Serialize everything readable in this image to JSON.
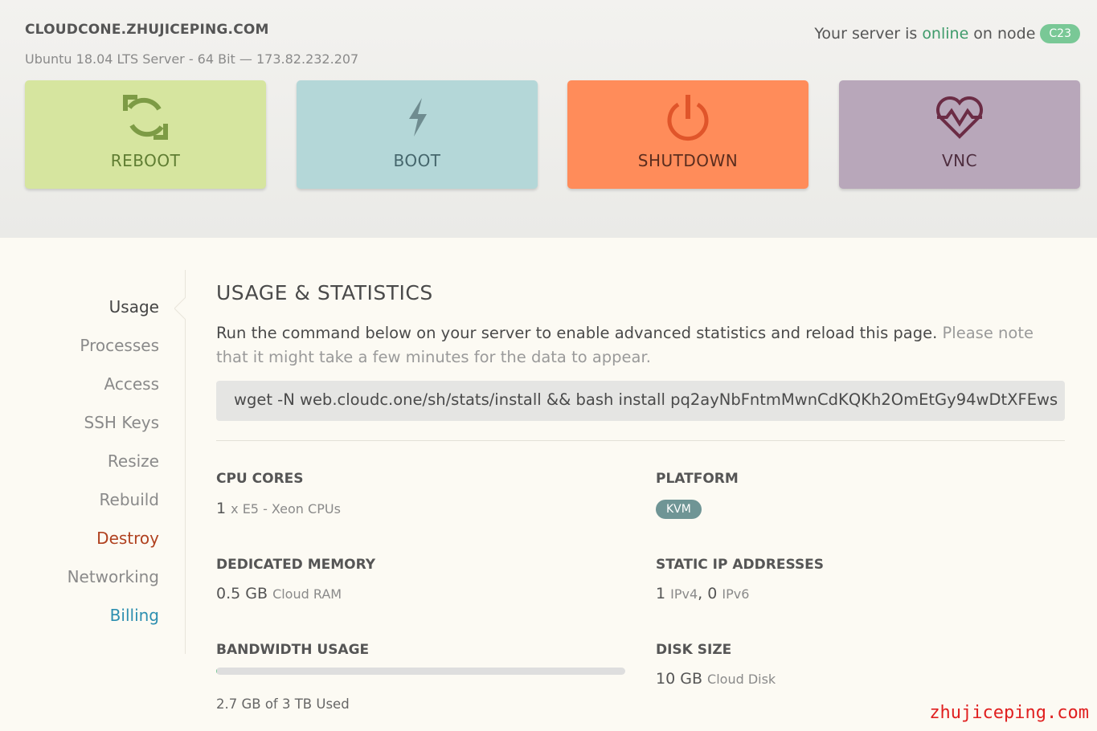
{
  "header": {
    "hostname": "CLOUDCONE.ZHUJICEPING.COM",
    "subline": "Ubuntu 18.04 LTS Server - 64 Bit — 173.82.232.207",
    "status_prefix": "Your server is",
    "status_state": "online",
    "status_suffix": "on node",
    "node": "C23"
  },
  "actions": [
    {
      "label": "REBOOT",
      "icon": "reboot-icon",
      "color": "#d6e59f"
    },
    {
      "label": "BOOT",
      "icon": "lightning-icon",
      "color": "#b4d7d8"
    },
    {
      "label": "SHUTDOWN",
      "icon": "power-icon",
      "color": "#ff8c5a"
    },
    {
      "label": "VNC",
      "icon": "heart-monitor-icon",
      "color": "#b8a7ba"
    }
  ],
  "nav": {
    "items": [
      "Usage",
      "Processes",
      "Access",
      "SSH Keys",
      "Resize",
      "Rebuild",
      "Destroy",
      "Networking",
      "Billing"
    ],
    "active": "Usage"
  },
  "main": {
    "title": "USAGE & STATISTICS",
    "desc": "Run the command below on your server to enable advanced statistics and reload this page.",
    "note": "Please note that it might take a few minutes for the data to appear.",
    "command": "wget -N web.cloudc.one/sh/stats/install && bash install pq2ayNbFntmMwnCdKQKh2OmEtGy94wDtXFEws",
    "stats": {
      "cpu": {
        "label": "CPU CORES",
        "value": "1",
        "unit": "x E5 - Xeon CPUs"
      },
      "platform": {
        "label": "PLATFORM",
        "value": "KVM"
      },
      "memory": {
        "label": "DEDICATED MEMORY",
        "value": "0.5 GB",
        "unit": "Cloud RAM"
      },
      "ip": {
        "label": "STATIC IP ADDRESSES",
        "v4": "1",
        "v4_unit": "IPv4",
        "sep": ",",
        "v6": "0",
        "v6_unit": "IPv6"
      },
      "bandwidth": {
        "label": "BANDWIDTH USAGE",
        "text": "2.7 GB of 3 TB Used",
        "fraction": 0.0009
      },
      "disk": {
        "label": "DISK SIZE",
        "value": "10 GB",
        "unit": "Cloud Disk"
      }
    }
  },
  "watermark": "zhujiceping.com",
  "colors": {
    "online": "#3f9b6b",
    "node_badge": "#79c896",
    "destroy": "#b0411f",
    "billing": "#2d8fb0"
  }
}
